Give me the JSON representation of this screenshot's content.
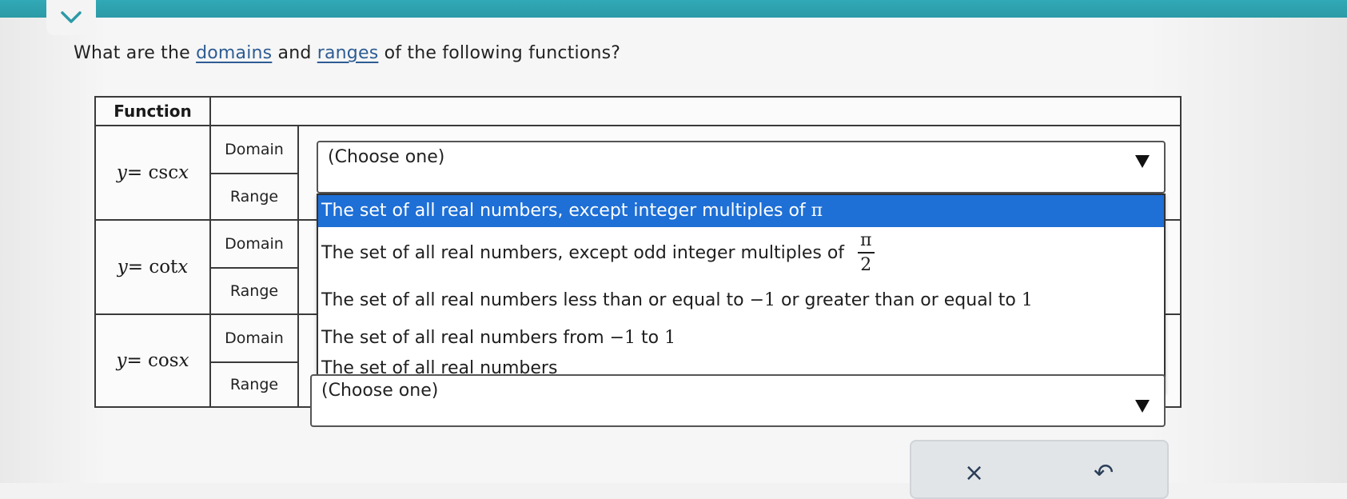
{
  "question": {
    "prefix": "What are the ",
    "link1": "domains",
    "middle": " and ",
    "link2": "ranges",
    "suffix": " of the following functions?"
  },
  "table": {
    "header": "Function",
    "rows": [
      {
        "y": "y",
        "eq": "=",
        "fn": "csc",
        "x": "x"
      },
      {
        "y": "y",
        "eq": "=",
        "fn": "cot",
        "x": "x"
      },
      {
        "y": "y",
        "eq": "=",
        "fn": "cos",
        "x": "x"
      }
    ],
    "domain_label": "Domain",
    "range_label": "Range"
  },
  "select_placeholder": "(Choose one)",
  "dropdown_options": [
    {
      "text": "The set of all real numbers, except integer multiples of ",
      "pi": "π"
    },
    {
      "text": "The set of all real numbers, except odd integer multiples of ",
      "num": "π",
      "den": "2"
    },
    {
      "text": "The set of all real numbers less than or equal to ",
      "a": "−1",
      "mid": " or greater than or equal to ",
      "b": "1"
    },
    {
      "text": "The set of all real numbers from ",
      "a": "−1",
      "mid": " to ",
      "b": "1"
    },
    {
      "text": "The set of all real numbers"
    }
  ],
  "actions": {
    "clear": "×",
    "undo": "↶"
  },
  "colors": {
    "accent": "#1e6fd6",
    "topbar": "#2fa3b0",
    "link": "#2d5c93"
  }
}
